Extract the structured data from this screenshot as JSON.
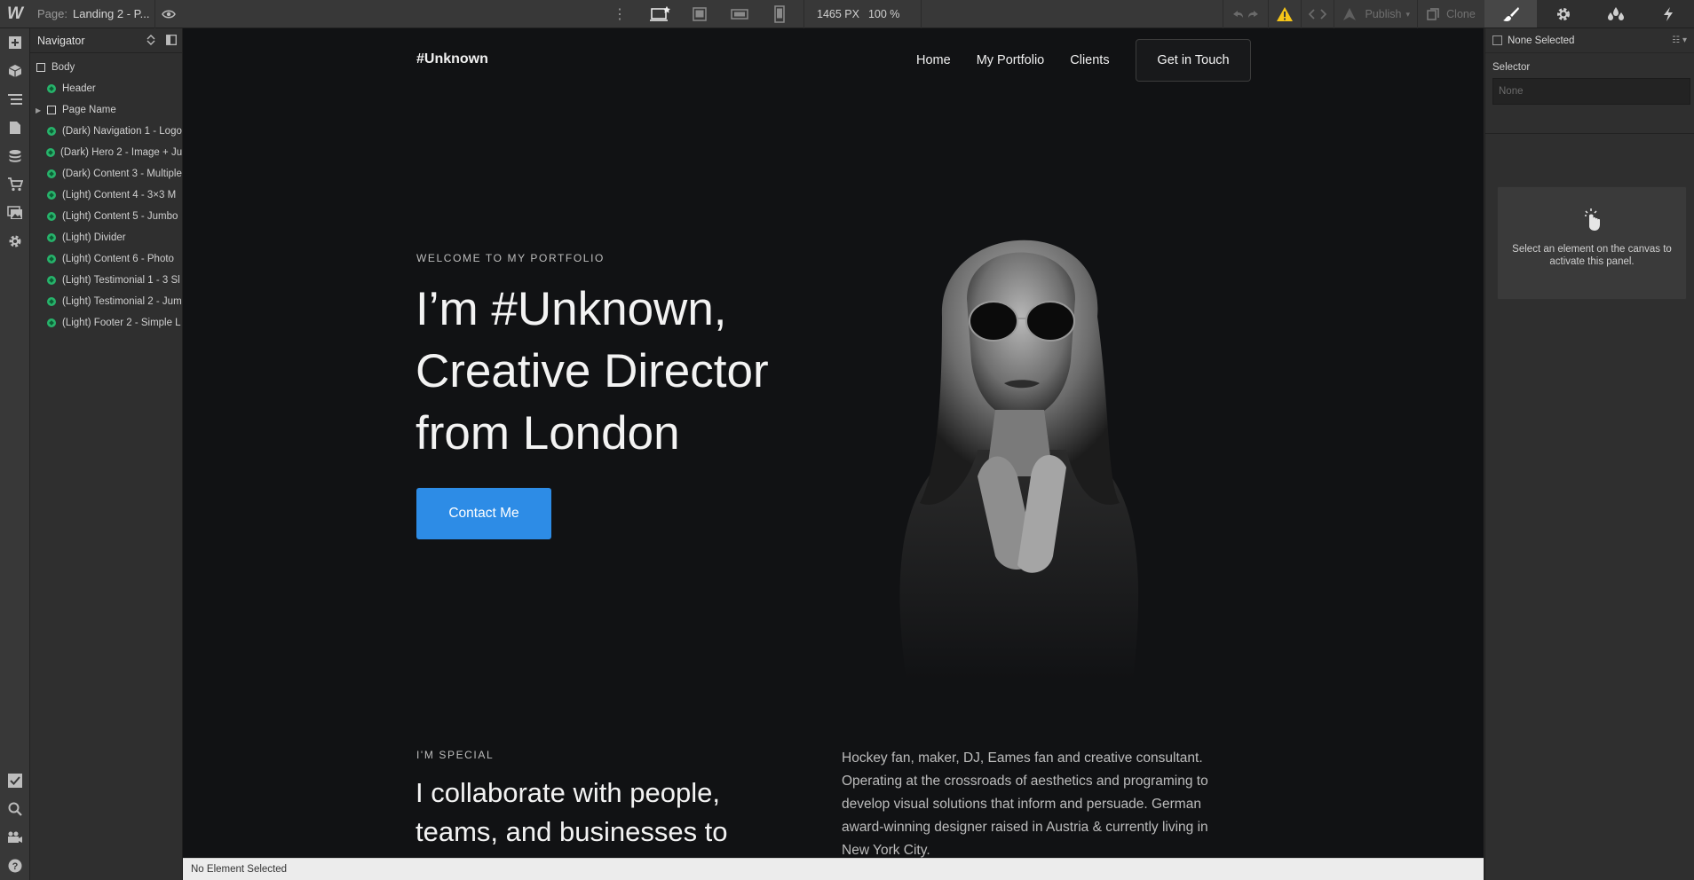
{
  "topbar": {
    "logo": "W",
    "page_label": "Page:",
    "page_value": "Landing 2 - P...",
    "breakpoint_width": "1465 PX",
    "zoom": "100 %",
    "publish_label": "Publish",
    "clone_label": "Clone"
  },
  "navigator": {
    "title": "Navigator",
    "items": [
      {
        "label": "Body"
      },
      {
        "label": "Header"
      },
      {
        "label": "Page Name"
      },
      {
        "label": "(Dark) Navigation 1 - Logo"
      },
      {
        "label": "(Dark) Hero 2 - Image + Ju"
      },
      {
        "label": "(Dark) Content 3 - Multiple"
      },
      {
        "label": "(Light) Content 4 - 3×3 M"
      },
      {
        "label": "(Light) Content 5 - Jumbo"
      },
      {
        "label": "(Light) Divider"
      },
      {
        "label": "(Light) Content 6 - Photo"
      },
      {
        "label": "(Light) Testimonial 1 - 3 Sl"
      },
      {
        "label": "(Light) Testimonial 2 - Jum"
      },
      {
        "label": "(Light) Footer 2 - Simple L"
      }
    ]
  },
  "site": {
    "logo": "#Unknown",
    "nav": [
      "Home",
      "My Portfolio",
      "Clients"
    ],
    "cta": "Get in Touch",
    "eyebrow": "WELCOME TO MY PORTFOLIO",
    "hero_heading": "I’m #Unknown, Creative Director from London",
    "contact_button": "Contact Me",
    "eyebrow2": "I'M SPECIAL",
    "sub_heading": "I collaborate with people, teams, and businesses to",
    "paragraph": "Hockey fan, maker, DJ, Eames fan and creative consultant. Operating at the crossroads of aesthetics and programing to develop visual solutions that inform and persuade. German award-winning designer raised in Austria & currently living in New York City."
  },
  "status_bar": "No Element Selected",
  "style_panel": {
    "selection": "None Selected",
    "selector_label": "Selector",
    "selector_placeholder": "None",
    "hint": "Select an element on the canvas to activate this panel."
  },
  "colors": {
    "accent_blue": "#2d8ce6",
    "canvas_bg": "#111214",
    "component_green": "#27b36b",
    "warning_yellow": "#f5c518"
  }
}
